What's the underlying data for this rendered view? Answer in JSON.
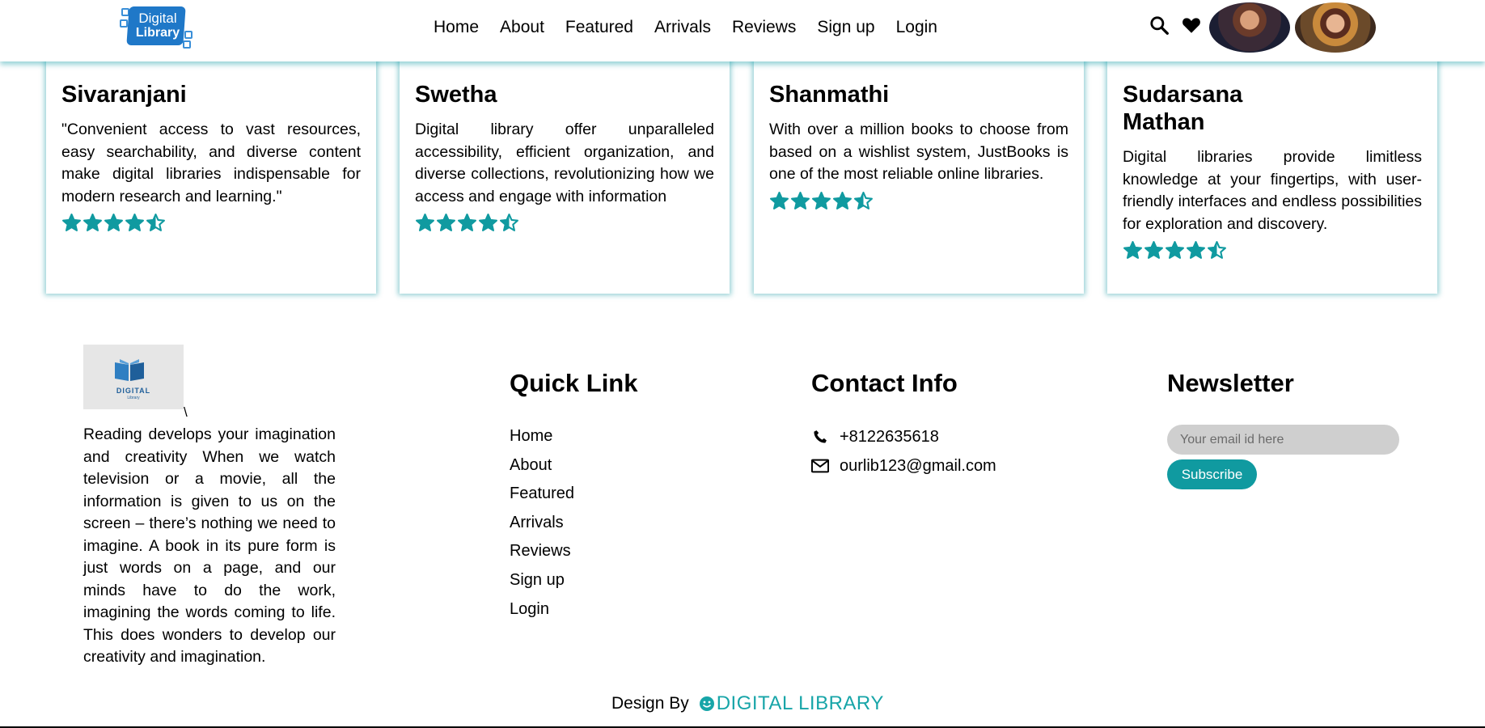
{
  "header": {
    "logo": {
      "line1": "Digital",
      "line2": "Library"
    },
    "nav": [
      "Home",
      "About",
      "Featured",
      "Arrivals",
      "Reviews",
      "Sign up",
      "Login"
    ],
    "icons": [
      "search-icon",
      "heart-icon"
    ]
  },
  "reviews": [
    {
      "name": "Sivaranjani",
      "text": "\"Convenient access to vast resources, easy searchability, and diverse content make digital libraries indispensable for modern research and learning.\"",
      "rating": 4.5
    },
    {
      "name": "Swetha",
      "text": "Digital library offer unparalleled accessibility, efficient organization, and diverse collections, revolutionizing how we access and engage with information",
      "rating": 4.5
    },
    {
      "name": "Shanmathi",
      "text": "With over a million books to choose from based on a wishlist system, JustBooks is one of the most reliable online libraries.",
      "rating": 4.5
    },
    {
      "name": "Sudarsana Mathan",
      "text": "Digital libraries provide limitless knowledge at your fingertips, with user-friendly interfaces and endless possibilities for exploration and discovery.",
      "rating": 4.5
    }
  ],
  "footer": {
    "logo": {
      "line1": "DIGITAL",
      "line2": "Library"
    },
    "backslash": "\\",
    "about": "Reading develops your imagination and creativity When we watch television or a movie, all the information is given to us on the screen – there’s nothing we need to imagine. A book in its pure form is just words on a page, and our minds have to do the work, imagining the words coming to life. This does wonders to develop our creativity and imagination.",
    "quick_link_title": "Quick Link",
    "quick_links": [
      "Home",
      "About",
      "Featured",
      "Arrivals",
      "Reviews",
      "Sign up",
      "Login"
    ],
    "contact_title": "Contact Info",
    "phone": "+8122635618",
    "email": "ourlib123@gmail.com",
    "newsletter_title": "Newsletter",
    "newsletter_placeholder": "Your email id here",
    "subscribe_label": "Subscribe",
    "credit_prefix": "Design By",
    "credit_brand": "DIGITAL LIBRARY"
  },
  "colors": {
    "accent": "#109aa0",
    "logo_blue": "#1f78c8"
  }
}
